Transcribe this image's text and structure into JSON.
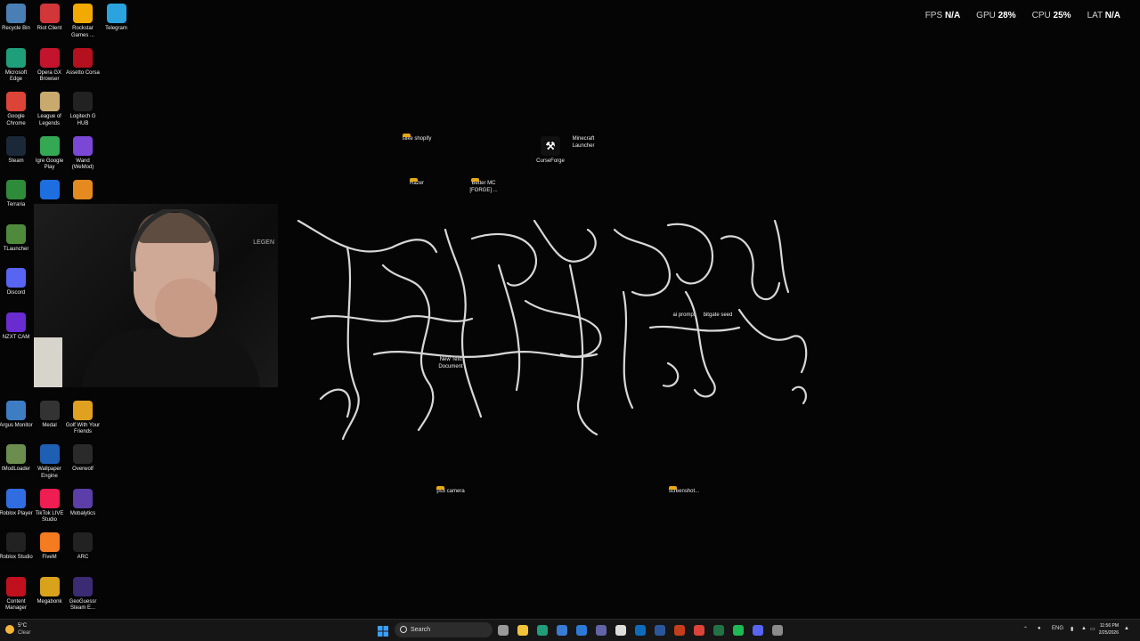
{
  "overlay": {
    "fps_label": "FPS",
    "fps_value": "N/A",
    "gpu_label": "GPU",
    "gpu_value": "28%",
    "cpu_label": "CPU",
    "cpu_value": "25%",
    "lat_label": "LAT",
    "lat_value": "N/A"
  },
  "left_icons": [
    {
      "label": "Recycle Bin",
      "icon": "recycle-bin-icon",
      "color": "#4a7fb5"
    },
    {
      "label": "Riot Client",
      "icon": "riot-client-icon",
      "color": "#d13639"
    },
    {
      "label": "Rockstar Games ...",
      "icon": "rockstar-games-icon",
      "color": "#f2a900"
    },
    {
      "label": "Telegram",
      "icon": "telegram-icon",
      "color": "#2aa3df"
    },
    {
      "label": "Microsoft Edge",
      "icon": "edge-icon",
      "color": "#1f9e7a"
    },
    {
      "label": "Opera GX Browser",
      "icon": "opera-gx-icon",
      "color": "#c3142e"
    },
    {
      "label": "Assetto Corsa",
      "icon": "assetto-corsa-icon",
      "color": "#b4101e"
    },
    {
      "label": "Google Chrome",
      "icon": "chrome-icon",
      "color": "#db4437"
    },
    {
      "label": "League of Legends",
      "icon": "league-of-legends-icon",
      "color": "#c8aa6e"
    },
    {
      "label": "Logitech G HUB",
      "icon": "logitech-g-hub-icon",
      "color": "#222222"
    },
    {
      "label": "Steam",
      "icon": "steam-icon",
      "color": "#1b2838"
    },
    {
      "label": "Igre Google Play",
      "icon": "google-play-games-icon",
      "color": "#34a853"
    },
    {
      "label": "Wand (WeMod)",
      "icon": "wand-icon",
      "color": "#7b47d6"
    },
    {
      "label": "Terraria",
      "icon": "terraria-icon",
      "color": "#2e8b3a"
    },
    {
      "label": "",
      "icon": "chat-app-icon",
      "color": "#1d6fe0"
    },
    {
      "label": "",
      "icon": "counter-strike-icon",
      "color": "#e58a1f"
    },
    {
      "label": "TLauncher",
      "icon": "tlauncher-icon",
      "color": "#4f8a3c"
    },
    {
      "label": "Discord",
      "icon": "discord-icon",
      "color": "#5865f2"
    },
    {
      "label": "NZXT CAM",
      "icon": "nzxt-cam-icon",
      "color": "#6a2bd1"
    },
    {
      "label": "Argus Monitor",
      "icon": "argus-monitor-icon",
      "color": "#3c7dc4"
    },
    {
      "label": "Medal",
      "icon": "medal-icon",
      "color": "#333333"
    },
    {
      "label": "Golf With Your Friends",
      "icon": "golf-with-your-friends-icon",
      "color": "#e0a020"
    },
    {
      "label": "tModLoader",
      "icon": "tmodloader-icon",
      "color": "#6b8e4e"
    },
    {
      "label": "Wallpaper Engine",
      "icon": "wallpaper-engine-icon",
      "color": "#1e5fb3"
    },
    {
      "label": "Overwolf",
      "icon": "overwolf-icon",
      "color": "#2a2a2a"
    },
    {
      "label": "Roblox Player",
      "icon": "roblox-player-icon",
      "color": "#2f6de0"
    },
    {
      "label": "TikTok LIVE Studio",
      "icon": "tiktok-live-studio-icon",
      "color": "#ee1d52"
    },
    {
      "label": "Mobalytics",
      "icon": "mobalytics-icon",
      "color": "#5b3ea8"
    },
    {
      "label": "Roblox Studio",
      "icon": "roblox-studio-icon",
      "color": "#222222"
    },
    {
      "label": "FiveM",
      "icon": "fivem-icon",
      "color": "#f47b20"
    },
    {
      "label": "ARC",
      "icon": "arc-icon",
      "color": "#222222"
    },
    {
      "label": "Content Manager",
      "icon": "content-manager-icon",
      "color": "#c0101e"
    },
    {
      "label": "Megabonk",
      "icon": "megabonk-icon",
      "color": "#d9a21b"
    },
    {
      "label": "GeoGuessr Steam E...",
      "icon": "geoguessr-icon",
      "color": "#3a2b73"
    }
  ],
  "desk_icons": [
    {
      "label": "slike shopify",
      "icon": "folder-icon",
      "kind": "folder"
    },
    {
      "label": "CurseForge",
      "icon": "curseforge-icon",
      "kind": "app"
    },
    {
      "label": "Minecraft Launcher",
      "icon": "document-icon",
      "kind": "doc"
    },
    {
      "label": "Razer",
      "icon": "folder-icon",
      "kind": "folder"
    },
    {
      "label": "Better MC [FORGE] ...",
      "icon": "folder-icon",
      "kind": "folder"
    },
    {
      "label": "ai prompt",
      "icon": "document-icon",
      "kind": "doc"
    },
    {
      "label": "bitgate seed",
      "icon": "document-icon",
      "kind": "doc"
    },
    {
      "label": "New Text Document",
      "icon": "document-icon",
      "kind": "doc"
    },
    {
      "label": "ps5 camera",
      "icon": "folder-icon",
      "kind": "folder"
    },
    {
      "label": "screenshot...",
      "icon": "folder-icon",
      "kind": "folder"
    }
  ],
  "webcam": {
    "overlay_text": "LEGEN"
  },
  "taskbar": {
    "search_label": "Search",
    "weather_temp": "5°C",
    "weather_text": "Clear",
    "lang": "ENG",
    "time": "11:56 PM",
    "date": "2/25/2026",
    "apps": [
      {
        "icon": "task-view-icon",
        "color": "#9a9a9a"
      },
      {
        "icon": "file-explorer-icon",
        "color": "#f3c33a"
      },
      {
        "icon": "edge-taskbar-icon",
        "color": "#1f9e7a"
      },
      {
        "icon": "microsoft-store-icon",
        "color": "#3a7bd5"
      },
      {
        "icon": "calendar-icon",
        "color": "#2d7ad6"
      },
      {
        "icon": "teams-icon",
        "color": "#6264a7"
      },
      {
        "icon": "notepad-icon",
        "color": "#dddddd"
      },
      {
        "icon": "outlook-icon",
        "color": "#0f6cbd"
      },
      {
        "icon": "word-icon",
        "color": "#2b579a"
      },
      {
        "icon": "powerpoint-icon",
        "color": "#c43e1c"
      },
      {
        "icon": "chrome-taskbar-icon",
        "color": "#db4437"
      },
      {
        "icon": "excel-icon",
        "color": "#217346"
      },
      {
        "icon": "spotify-icon",
        "color": "#1db954"
      },
      {
        "icon": "discord-taskbar-icon",
        "color": "#5865f2"
      },
      {
        "icon": "settings-icon",
        "color": "#8a8a8a"
      }
    ]
  }
}
